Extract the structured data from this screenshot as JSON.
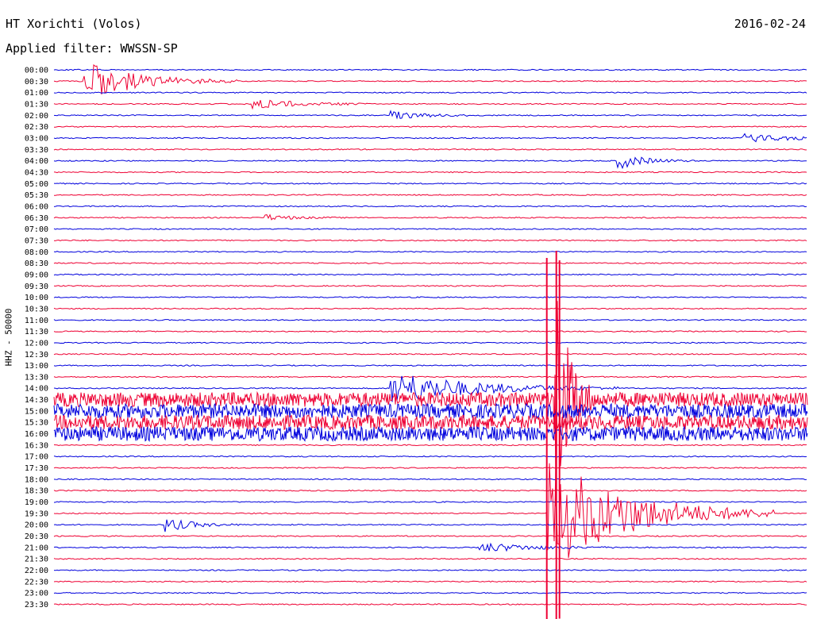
{
  "header": {
    "station": "HT Xorichti (Volos)",
    "date": "2016-02-24",
    "filter": "Applied filter: WWSSN-SP",
    "channel": "HHZ - 50000"
  },
  "colors": {
    "trace_a": "#0000dd",
    "trace_b": "#ee0033",
    "label": "#000000"
  },
  "chart_data": {
    "type": "line",
    "title": "HT Xorichti (Volos)",
    "subtitle": "Applied filter: WWSSN-SP",
    "ylabel": "HHZ - 50000",
    "row_interval_minutes": 30,
    "rows": [
      "00:00",
      "00:30",
      "01:00",
      "01:30",
      "02:00",
      "02:30",
      "03:00",
      "03:30",
      "04:00",
      "04:30",
      "05:00",
      "05:30",
      "06:00",
      "06:30",
      "07:00",
      "07:30",
      "08:00",
      "08:30",
      "09:00",
      "09:30",
      "10:00",
      "10:30",
      "11:00",
      "11:30",
      "12:00",
      "12:30",
      "13:00",
      "13:30",
      "14:00",
      "14:30",
      "15:00",
      "15:30",
      "16:00",
      "16:30",
      "17:00",
      "17:30",
      "18:00",
      "18:30",
      "19:00",
      "19:30",
      "20:00",
      "20:30",
      "21:00",
      "21:30",
      "22:00",
      "22:30",
      "23:00",
      "23:30"
    ],
    "trace_colors": [
      "blue",
      "red"
    ],
    "noisy_rows": [
      "14:30",
      "15:00",
      "15:30",
      "16:00"
    ],
    "events": [
      {
        "row": "00:30",
        "minute": 1.3,
        "amplitude": 2.0,
        "duration_min": 2.0
      },
      {
        "row": "01:30",
        "minute": 8.0,
        "amplitude": 0.6,
        "duration_min": 1.5
      },
      {
        "row": "02:00",
        "minute": 13.5,
        "amplitude": 0.4,
        "duration_min": 1.2
      },
      {
        "row": "03:00",
        "minute": 27.5,
        "amplitude": 0.4,
        "duration_min": 2.0
      },
      {
        "row": "04:00",
        "minute": 22.5,
        "amplitude": 0.8,
        "duration_min": 1.0
      },
      {
        "row": "06:30",
        "minute": 8.5,
        "amplitude": 0.3,
        "duration_min": 1.0
      },
      {
        "row": "14:00",
        "minute": 13.5,
        "amplitude": 1.8,
        "duration_min": 3.0
      },
      {
        "row": "14:30",
        "minute": 20.0,
        "amplitude": 12.0,
        "duration_min": 0.5
      },
      {
        "row": "19:30",
        "minute": 19.7,
        "amplitude": 6.0,
        "duration_min": 3.0
      },
      {
        "row": "20:00",
        "minute": 4.5,
        "amplitude": 0.7,
        "duration_min": 1.0
      },
      {
        "row": "21:00",
        "minute": 17.0,
        "amplitude": 0.5,
        "duration_min": 2.0
      }
    ]
  }
}
